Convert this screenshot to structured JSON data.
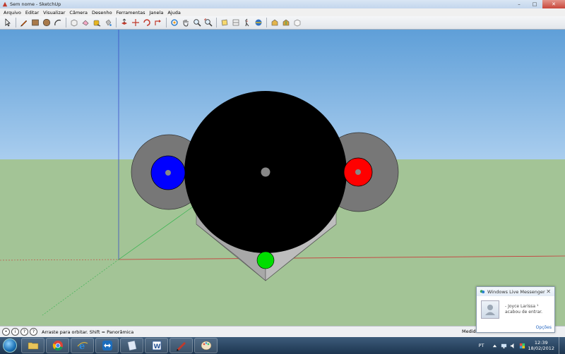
{
  "window": {
    "title": "Sem nome - SketchUp"
  },
  "menu": [
    "Arquivo",
    "Editar",
    "Visualizar",
    "Câmera",
    "Desenho",
    "Ferramentas",
    "Janela",
    "Ajuda"
  ],
  "toolbar": {
    "tools": [
      "select",
      "pencil",
      "rectangle",
      "circle",
      "arc",
      "sep",
      "eraser-shape",
      "eraser",
      "paint-bucket",
      "push-pull",
      "follow-me",
      "sep",
      "move",
      "rotate",
      "scale",
      "offset",
      "sep",
      "orbit",
      "pan",
      "zoom",
      "zoom-window",
      "zoom-extents",
      "sep",
      "section",
      "walk",
      "look-around",
      "position-camera",
      "sep",
      "components",
      "materials",
      "styles"
    ]
  },
  "status": {
    "hint": "Arraste para orbitar. Shift = Panorâmica",
    "measure_label": "Medidas"
  },
  "taskbar": {
    "apps": [
      "explorer",
      "chrome",
      "internet-explorer",
      "teamviewer",
      "notepad",
      "word",
      "sketchup",
      "paint"
    ],
    "language": "PT",
    "time": "12:39",
    "date": "18/02/2012"
  },
  "notification": {
    "app": "Windows Live Messenger",
    "name": "- Joyce Larissa ¹",
    "message": "acabou de entrar.",
    "options_label": "Opções"
  },
  "colors": {
    "sky": "#6aa9dd",
    "ground": "#a3c496",
    "red_disc": "#ff0000",
    "blue_disc": "#0000ff",
    "green_disc": "#00dd00"
  }
}
